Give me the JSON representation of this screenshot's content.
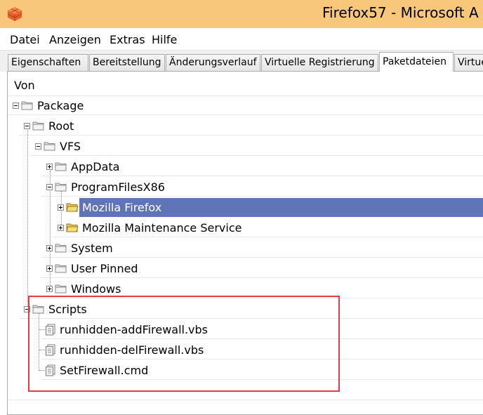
{
  "window": {
    "title": "Firefox57 - Microsoft A",
    "app_icon": "waffle-cube-icon"
  },
  "menu": {
    "items": [
      "Datei",
      "Anzeigen",
      "Extras",
      "Hilfe"
    ]
  },
  "tabs": {
    "items": [
      "Eigenschaften",
      "Bereitstellung",
      "Änderungsverlauf",
      "Virtuelle Registrierung",
      "Paketdateien",
      "Virtue"
    ],
    "active": "Paketdateien"
  },
  "files": {
    "column_header": "Von",
    "tree": {
      "package": "Package",
      "root": "Root",
      "vfs": "VFS",
      "appdata": "AppData",
      "programfiles": "ProgramFilesX86",
      "mozilla_firefox": "Mozilla Firefox",
      "mozilla_maintenance": "Mozilla Maintenance Service",
      "system": "System",
      "user_pinned": "User Pinned",
      "windows": "Windows",
      "scripts": "Scripts",
      "file1": "runhidden-addFirewall.vbs",
      "file2": "runhidden-delFirewall.vbs",
      "file3": "SetFirewall.cmd"
    },
    "selected": "Mozilla Firefox"
  },
  "colors": {
    "titlebar": "#f9c77b",
    "selection": "#5f73b7",
    "highlight_box": "#e03c4a",
    "folder_open": "#f0d77a",
    "folder_closed": "#d9d9d9"
  }
}
